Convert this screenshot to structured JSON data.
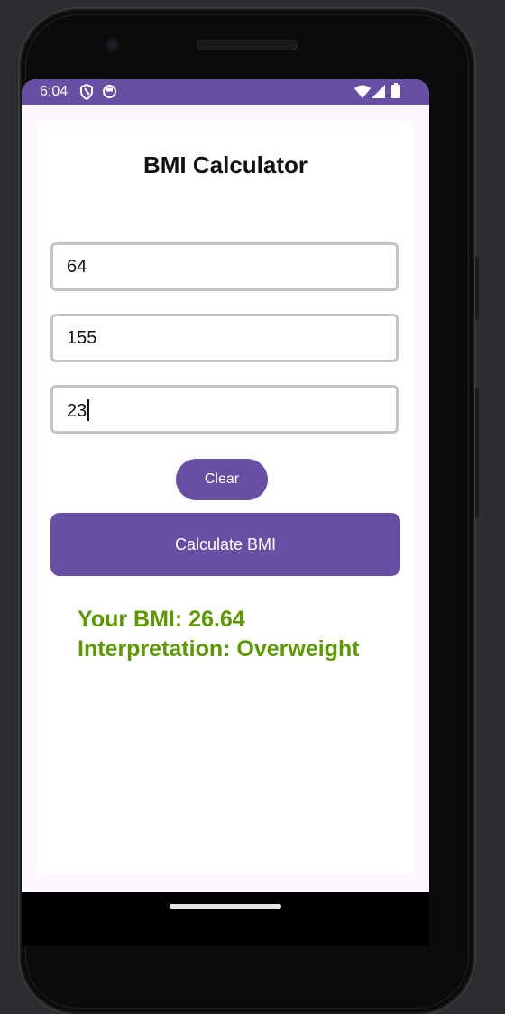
{
  "status_bar": {
    "time": "6:04",
    "left_icons": [
      "shield-icon",
      "app-circle-icon"
    ],
    "right_icons": [
      "wifi-icon",
      "cellular-signal-icon",
      "battery-icon"
    ]
  },
  "app": {
    "title": "BMI Calculator",
    "inputs": [
      {
        "value": "64"
      },
      {
        "value": "155"
      },
      {
        "value": "23"
      }
    ],
    "clear_label": "Clear",
    "calculate_label": "Calculate BMI",
    "result_bmi": "Your BMI: 26.64",
    "result_interpretation": "Interpretation: Overweight"
  },
  "colors": {
    "accent": "#6750a4",
    "result_text": "#5a9a00",
    "screen_background": "#fdf7ff"
  }
}
